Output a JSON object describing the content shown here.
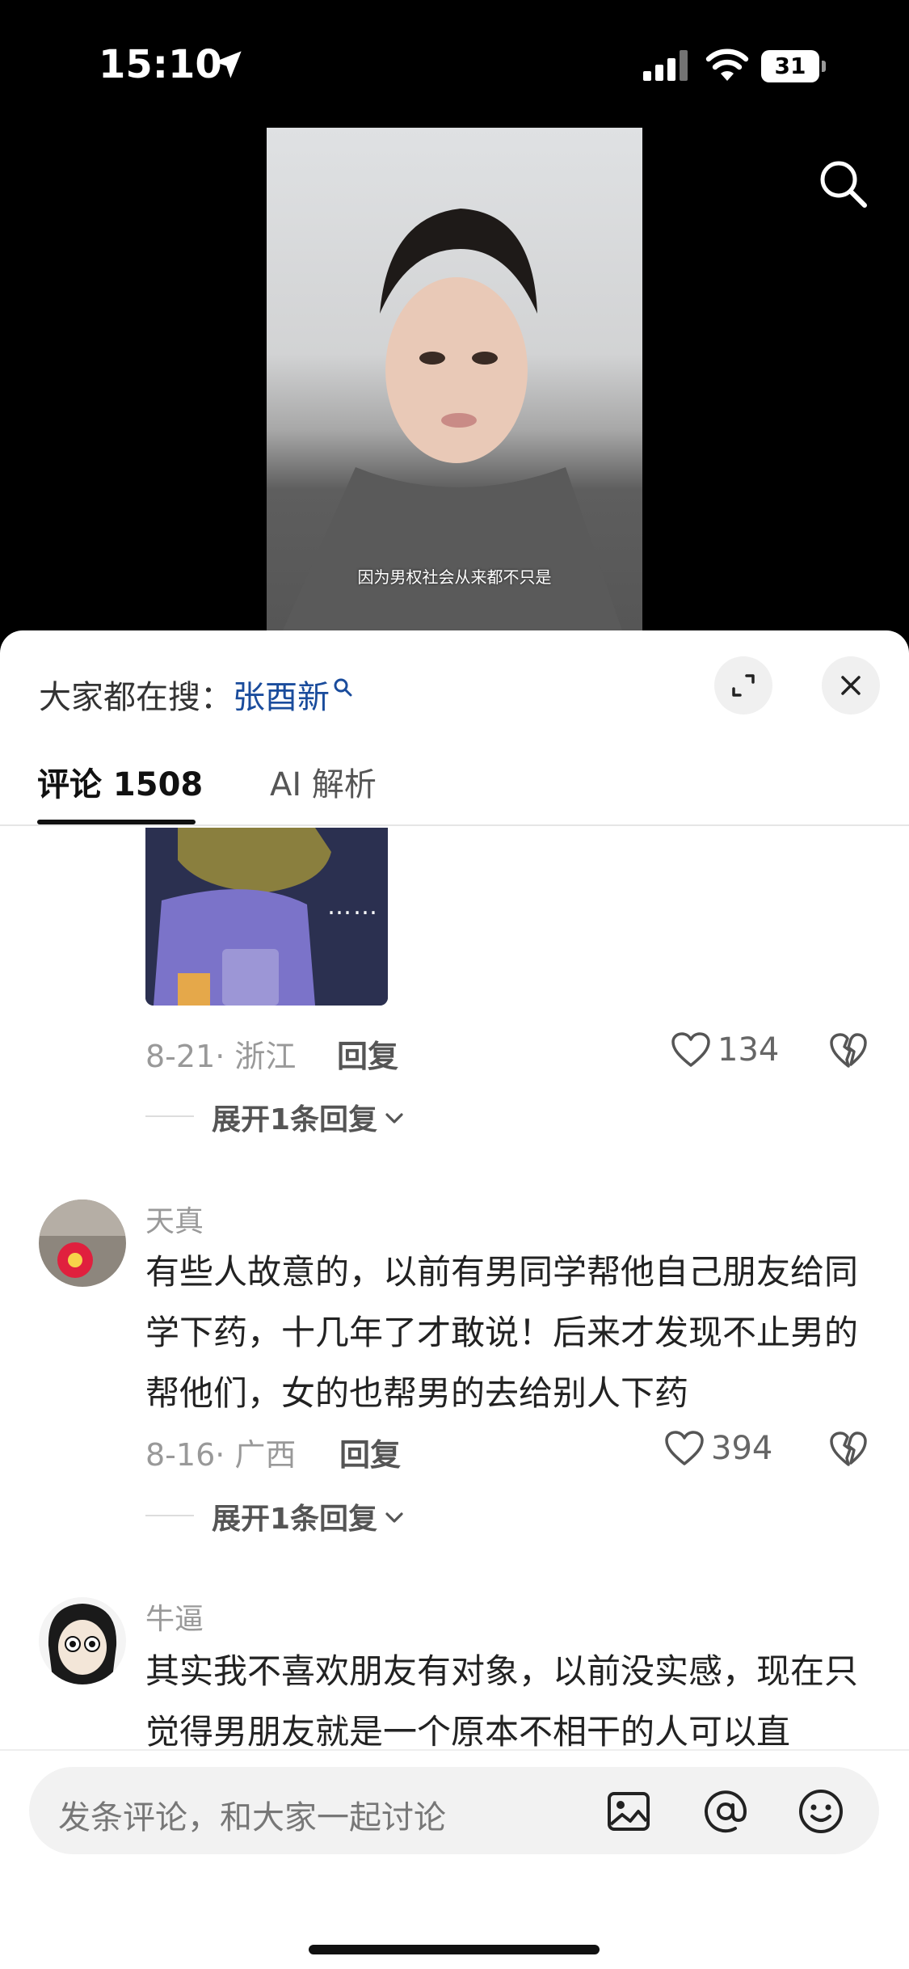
{
  "status_bar": {
    "time": "15:10",
    "battery": "31"
  },
  "video": {
    "subtitle": "因为男权社会从来都不只是"
  },
  "hot_search": {
    "prefix": "大家都在搜：",
    "term": "张酉新"
  },
  "tabs": [
    {
      "label": "评论 1508",
      "active": true
    },
    {
      "label": "AI 解析",
      "active": false
    }
  ],
  "comments": [
    {
      "has_image": true,
      "image_caption": "……",
      "date_location": "8-21· 浙江",
      "reply_label": "回复",
      "likes": "134",
      "expand_label": "展开1条回复"
    },
    {
      "username": "天真",
      "text": "有些人故意的，以前有男同学帮他自己朋友给同学下药，十几年了才敢说！后来才发现不止男的帮他们，女的也帮男的去给别人下药",
      "date_location": "8-16· 广西",
      "reply_label": "回复",
      "likes": "394",
      "expand_label": "展开1条回复"
    },
    {
      "username": "牛逼",
      "text": "其实我不喜欢朋友有对象，以前没实感，现在只觉得男朋友就是一个原本不相干的人可以直"
    }
  ],
  "input": {
    "placeholder": "发条评论，和大家一起讨论"
  },
  "icons": {
    "location": "location-arrow-icon",
    "signal": "cellular-signal-icon",
    "wifi": "wifi-icon",
    "search": "search-icon",
    "expand": "expand-icon",
    "close": "close-icon",
    "like": "heart-icon",
    "dislike": "broken-heart-icon",
    "image": "image-icon",
    "mention": "at-icon",
    "emoji": "emoji-icon"
  },
  "colors": {
    "hot_term": "#1a4c9c",
    "background": "#000000",
    "sheet": "#ffffff"
  }
}
